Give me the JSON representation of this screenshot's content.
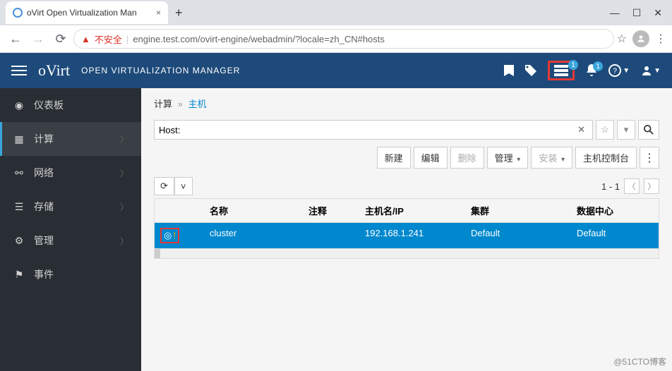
{
  "browser": {
    "tab_title": "oVirt Open Virtualization Man",
    "insecure_label": "不安全",
    "url": "engine.test.com/ovirt-engine/webadmin/?locale=zh_CN#hosts"
  },
  "header": {
    "brand": "oVirt",
    "subtitle": "OPEN VIRTUALIZATION MANAGER",
    "tasks_badge": "1",
    "alerts_badge": "1"
  },
  "sidebar": {
    "items": [
      {
        "label": "仪表板"
      },
      {
        "label": "计算"
      },
      {
        "label": "网络"
      },
      {
        "label": "存储"
      },
      {
        "label": "管理"
      },
      {
        "label": "事件"
      }
    ]
  },
  "breadcrumb": {
    "root": "计算",
    "current": "主机"
  },
  "search": {
    "prefix": "Host:"
  },
  "toolbar": {
    "btn_new": "新建",
    "btn_edit": "编辑",
    "btn_delete": "删除",
    "btn_manage": "管理",
    "btn_install": "安装",
    "btn_console": "主机控制台"
  },
  "pager": {
    "range": "1 - 1"
  },
  "grid": {
    "columns": {
      "name": "名称",
      "comment": "注释",
      "hostip": "主机名/IP",
      "cluster": "集群",
      "dc": "数据中心"
    },
    "rows": [
      {
        "name": "cluster",
        "comment": "",
        "hostip": "192.168.1.241",
        "cluster": "Default",
        "dc": "Default"
      }
    ]
  },
  "watermark": "@51CTO博客"
}
